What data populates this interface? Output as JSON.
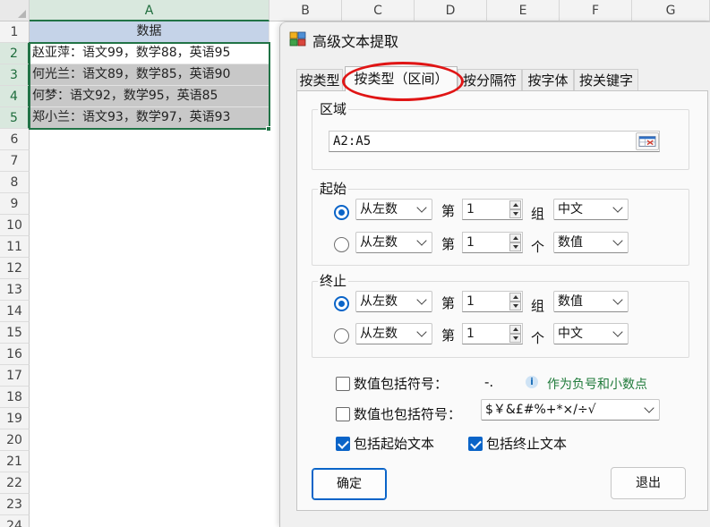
{
  "spreadsheet": {
    "columns": [
      "A",
      "B",
      "C",
      "D",
      "E",
      "F",
      "G"
    ],
    "rows": [
      "1",
      "2",
      "3",
      "4",
      "5",
      "6",
      "7",
      "8",
      "9",
      "10",
      "11",
      "12",
      "13",
      "14",
      "15",
      "16",
      "17",
      "18",
      "19",
      "20",
      "21",
      "22",
      "23",
      "24"
    ],
    "header_cell": "数据",
    "data": [
      "赵亚萍：语文99，数学88，英语95",
      "何光兰：语文89，数学85，英语90",
      "何梦：语文92，数学95，英语85",
      "郑小兰：语文93，数学97，英语93"
    ]
  },
  "dialog": {
    "title": "高级文本提取",
    "tabs": [
      "按类型",
      "按类型（区间）",
      "按分隔符",
      "按字体",
      "按关键字"
    ],
    "active_tab": 1,
    "region": {
      "label": "区域",
      "value": "A2:A5"
    },
    "start": {
      "label": "起始",
      "rows": [
        {
          "selected": true,
          "direction": "从左数",
          "di": "第",
          "number": "1",
          "unit": "组",
          "type": "中文"
        },
        {
          "selected": false,
          "direction": "从左数",
          "di": "第",
          "number": "1",
          "unit": "个",
          "type": "数值"
        }
      ]
    },
    "end": {
      "label": "终止",
      "rows": [
        {
          "selected": true,
          "direction": "从左数",
          "di": "第",
          "number": "1",
          "unit": "组",
          "type": "数值"
        },
        {
          "selected": false,
          "direction": "从左数",
          "di": "第",
          "number": "1",
          "unit": "个",
          "type": "中文"
        }
      ]
    },
    "options": {
      "num_symbol_label": "数值包括符号：",
      "num_symbol_value": "-.",
      "num_symbol_hint": "作为负号和小数点",
      "num_symbol_checked": false,
      "num_also_label": "数值也包括符号：",
      "num_also_value": "$￥&£#%+*×/÷√",
      "num_also_checked": false,
      "include_start_label": "包括起始文本",
      "include_start_checked": true,
      "include_end_label": "包括终止文本",
      "include_end_checked": true
    },
    "buttons": {
      "ok": "确定",
      "exit": "退出"
    }
  }
}
